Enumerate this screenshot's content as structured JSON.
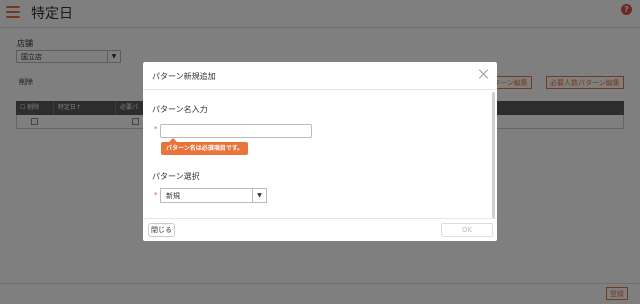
{
  "header": {
    "title": "特定日",
    "menu_icon": "hamburger-icon",
    "help_icon": "help-icon",
    "help_glyph": "?"
  },
  "store": {
    "label": "店舗",
    "value": "国立店",
    "caret": "▼"
  },
  "toolbar": {
    "delete_label": "削除",
    "pattern_edit_label": "パターン編集",
    "required_staff_edit_label": "必要人数パターン編集"
  },
  "grid": {
    "columns": [
      "削除",
      "特定日↑",
      "必要パ"
    ],
    "rows": [
      {
        "delete": "",
        "date": ""
      }
    ]
  },
  "footer": {
    "register_label": "登録"
  },
  "modal": {
    "title": "パターン新規追加",
    "name_section_label": "パターン名入力",
    "required_mark": "*",
    "name_value": "",
    "name_error": "パターン名は必須項目です。",
    "pattern_section_label": "パターン選択",
    "pattern_value": "新規",
    "pattern_caret": "▼",
    "close_label": "閉じる",
    "ok_label": "OK"
  },
  "colors": {
    "accent": "#e8743b",
    "error": "#d9534f",
    "grid_header": "#5a5a5a"
  }
}
